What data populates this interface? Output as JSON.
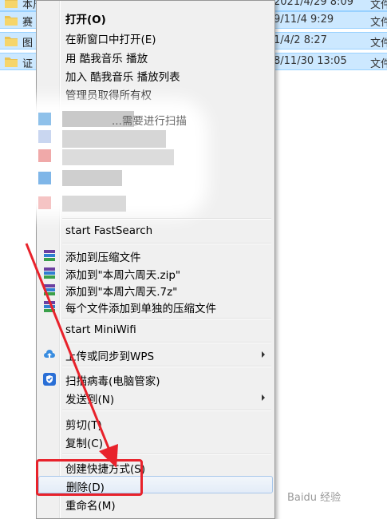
{
  "explorer": {
    "rows": [
      {
        "name": "本周六周天",
        "date": "2021/4/29 8:09",
        "type": "文件"
      },
      {
        "name": "赛",
        "date": "9/11/4 9:29",
        "type": "文件"
      },
      {
        "name": "图",
        "date": "1/4/2 8:27",
        "type": "文件"
      },
      {
        "name": "证",
        "date": "8/11/30 13:05",
        "type": "文件"
      }
    ]
  },
  "menu": {
    "open": "打开(O)",
    "open_new_window": "在新窗口中打开(E)",
    "play_kuwo": "用 酷我音乐 播放",
    "add_kuwo_playlist": "加入 酷我音乐 播放列表",
    "take_ownership": "管理员取得所有权",
    "blurred_scan": "...需要进行扫描",
    "start_fastsearch": "start FastSearch",
    "add_archive": "添加到压缩文件",
    "add_zip": "添加到\"本周六周天.zip\"",
    "add_7z": "添加到\"本周六周天.7z\"",
    "add_each_archive": "每个文件添加到单独的压缩文件",
    "start_miniwifi": "start MiniWifi",
    "upload_wps": "上传或同步到WPS",
    "scan_virus": "扫描病毒(电脑管家)",
    "send_to": "发送到(N)",
    "cut": "剪切(T)",
    "copy": "复制(C)",
    "create_shortcut": "创建快捷方式(S)",
    "delete": "删除(D)",
    "rename": "重命名(M)"
  },
  "watermark": "Baidu 经验",
  "colors": {
    "highlight_red": "#e8222b",
    "selection_bg": "#cce8ff",
    "menu_bg": "#f0f0f0"
  }
}
